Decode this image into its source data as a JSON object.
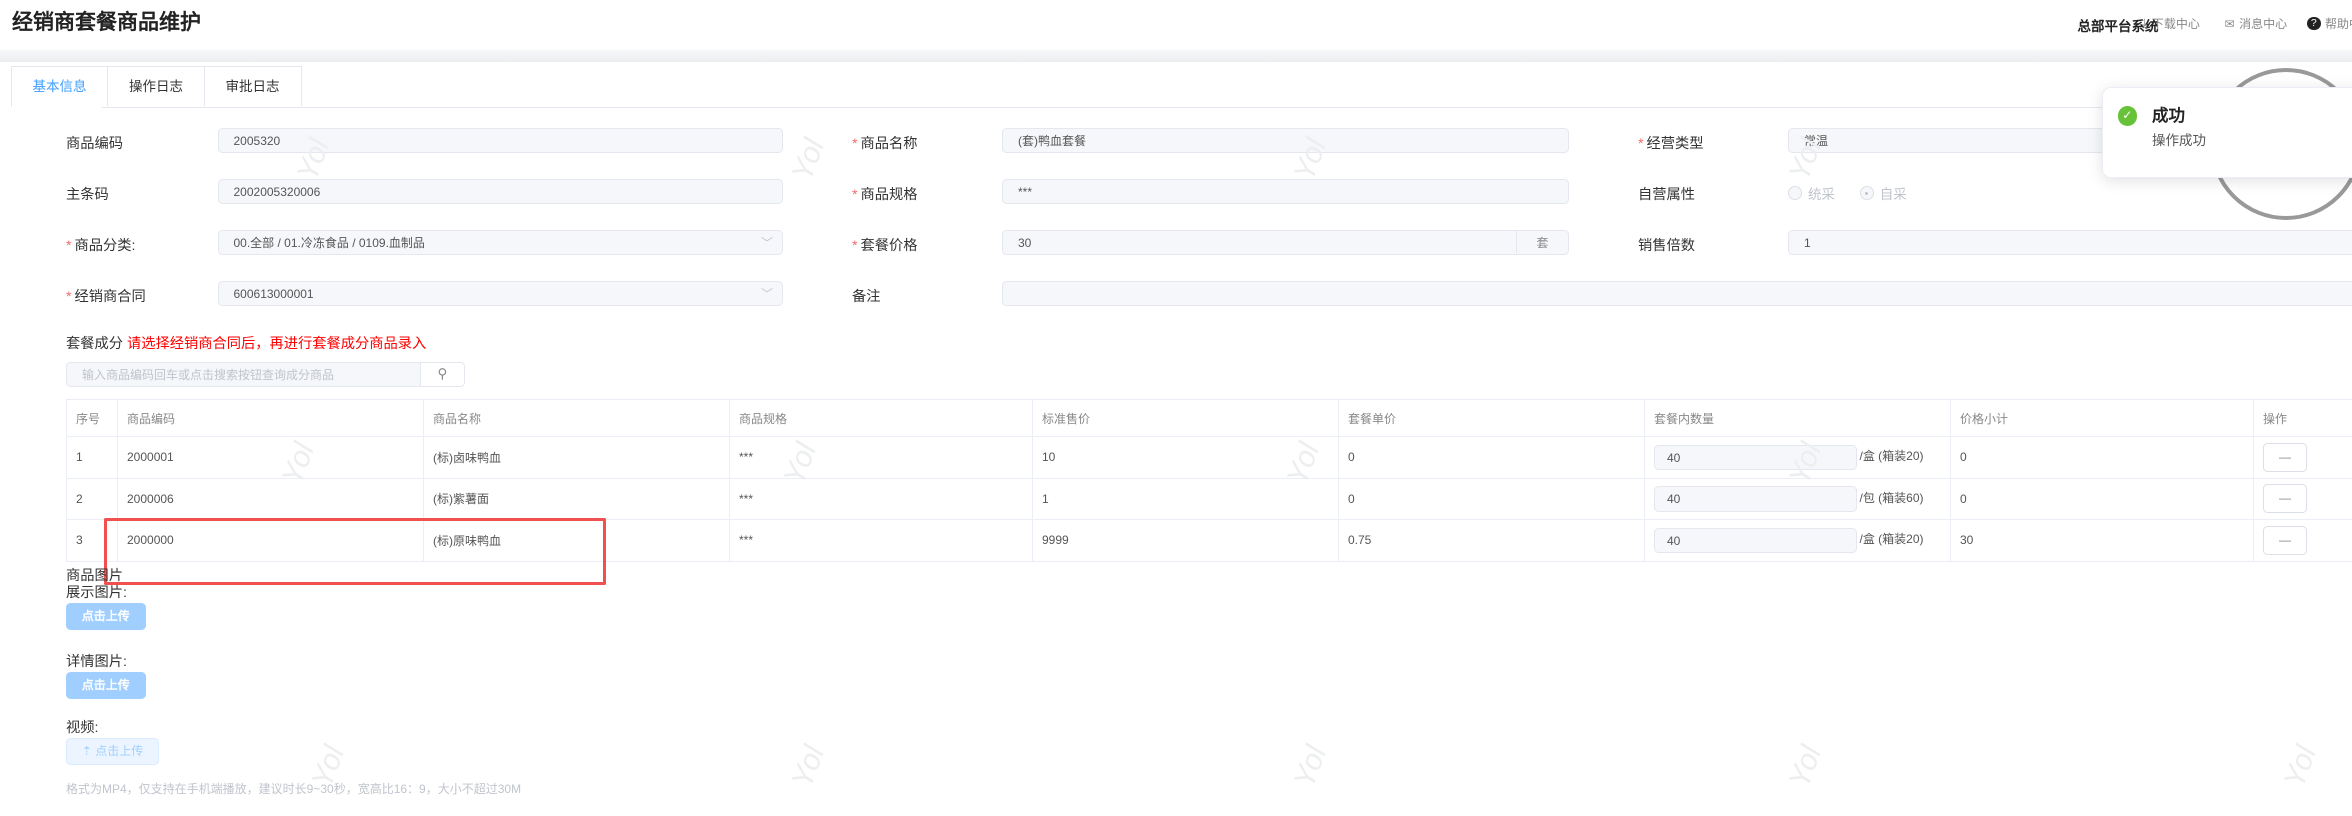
{
  "header": {
    "title": "经销商套餐商品维护",
    "system": "总部平台系统",
    "download": "下载中心",
    "messages": "消息中心",
    "help": "帮助中心"
  },
  "tabs": [
    "基本信息",
    "操作日志",
    "审批日志"
  ],
  "form": {
    "code_label": "商品编码",
    "code": "2005320",
    "barcode_label": "主条码",
    "barcode": "2002005320006",
    "category_label": "商品分类:",
    "category": "00.全部 / 01.冷冻食品 / 0109.血制品",
    "contract_label": "经销商合同",
    "contract": "600613000001",
    "name_label": "商品名称",
    "name": "(套)鸭血套餐",
    "spec_label": "商品规格",
    "spec": "***",
    "price_label": "套餐价格",
    "price": "30",
    "price_unit": "套",
    "remark_label": "备注",
    "remark": "",
    "biz_type_label": "经营类型",
    "biz_type": "常温",
    "self_label": "自营属性",
    "self_options": [
      "统采",
      "自采"
    ],
    "self_selected": "自采",
    "multiple_label": "销售倍数",
    "multiple": "1"
  },
  "components": {
    "label": "套餐成分",
    "warning": "请选择经销商合同后，再进行套餐成分商品录入",
    "search_placeholder": "输入商品编码回车或点击搜索按钮查询成分商品"
  },
  "table": {
    "headers": [
      "序号",
      "商品编码",
      "商品名称",
      "商品规格",
      "标准售价",
      "套餐单价",
      "套餐内数量",
      "价格小计",
      "操作"
    ],
    "rows": [
      {
        "no": "1",
        "code": "2000001",
        "name": "(标)卤味鸭血",
        "spec": "***",
        "std_price": "10",
        "unit_price": "0",
        "qty": "40",
        "unit": "/盒 (箱装20)",
        "subtotal": "0",
        "op": "—"
      },
      {
        "no": "2",
        "code": "2000006",
        "name": "(标)紫薯面",
        "spec": "***",
        "std_price": "1",
        "unit_price": "0",
        "qty": "40",
        "unit": "/包 (箱装60)",
        "subtotal": "0",
        "op": "—"
      },
      {
        "no": "3",
        "code": "2000000",
        "name": "(标)原味鸭血",
        "spec": "***",
        "std_price": "9999",
        "unit_price": "0.75",
        "qty": "40",
        "unit": "/盒 (箱装20)",
        "subtotal": "30",
        "op": "—"
      }
    ]
  },
  "images": {
    "section": "商品图片",
    "display_label": "展示图片:",
    "detail_label": "详情图片:",
    "upload": "点击上传",
    "video_label": "视频:",
    "video_upload": "点击上传",
    "video_hint": "格式为MP4，仅支持在手机端播放，建议时长9~30秒，宽高比16：9，大小不超过30M"
  },
  "toast": {
    "title": "成功",
    "message": "操作成功"
  },
  "watermark": "Yol",
  "colors": {
    "primary": "#409eff",
    "required": "#f56c6c",
    "warning": "#ff0000",
    "success": "#67c23a",
    "highlight": "#f05050"
  }
}
